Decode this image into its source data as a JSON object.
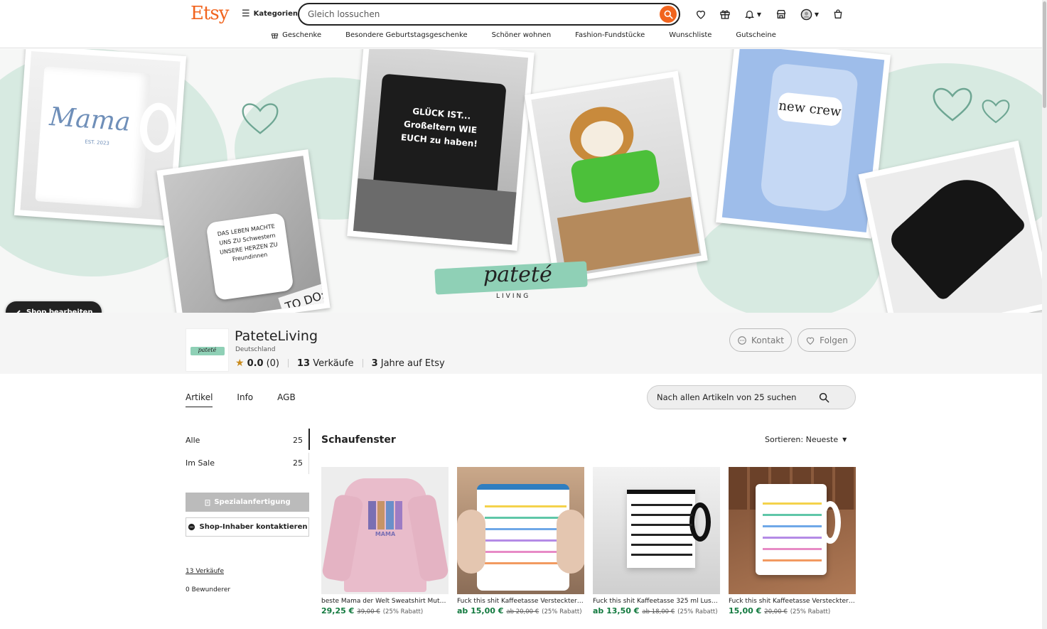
{
  "header": {
    "logo": "Etsy",
    "categories_label": "Kategorien",
    "search_placeholder": "Gleich lossuchen",
    "subnav": [
      "Geschenke",
      "Besondere Geburtstagsgeschenke",
      "Schöner wohnen",
      "Fashion-Fundstücke",
      "Wunschliste",
      "Gutscheine"
    ]
  },
  "banner": {
    "edit_label": "Shop bearbeiten",
    "brand_script": "pateté",
    "brand_sub": "LIVING",
    "mug_text": "Mama",
    "mug_sub": "EST. 2023",
    "pillow_text": "GLÜCK IST... Großeltern WIE EUCH zu haben!",
    "onesie_text": "new crew",
    "coaster_text": "DAS LEBEN MACHTE UNS ZU Schwestern UNSERE HERZEN ZU Freundinnen",
    "todo_text": "TO DO:"
  },
  "shop": {
    "name": "PateteLiving",
    "country": "Deutschland",
    "rating": "0.0",
    "rating_count": "(0)",
    "sales_num": "13",
    "sales_label": "Verkäufe",
    "years_num": "3",
    "years_label": "Jahre auf Etsy",
    "contact_label": "Kontakt",
    "follow_label": "Folgen",
    "avatar_text": "pateté"
  },
  "tabs": [
    "Artikel",
    "Info",
    "AGB"
  ],
  "item_search_placeholder": "Nach allen Artikeln von 25 suchen",
  "sidebar": {
    "sections": [
      {
        "label": "Alle",
        "count": "25"
      },
      {
        "label": "Im Sale",
        "count": "25"
      }
    ],
    "custom_label": "Spezialanfertigung",
    "contact_owner_label": "Shop-Inhaber kontaktieren",
    "sales_link": "13 Verkäufe",
    "admirers": "0 Bewunderer"
  },
  "listings": {
    "heading": "Schaufenster",
    "sort_label": "Sortieren: Neueste",
    "items": [
      {
        "title": "beste Mama der Welt Sweatshirt Mutte...",
        "price": "29,25 €",
        "old": "39,00 €",
        "discount": "(25% Rabatt)"
      },
      {
        "title": "Fuck this shit Kaffeetasse Versteckter ...",
        "price": "ab 15,00 €",
        "old": "ab 20,00 €",
        "discount": "(25% Rabatt)"
      },
      {
        "title": "Fuck this shit Kaffeetasse 325 ml Lusti...",
        "price": "ab 13,50 €",
        "old": "ab 18,00 €",
        "discount": "(25% Rabatt)"
      },
      {
        "title": "Fuck this shit Kaffeetasse Versteckter ...",
        "price": "15,00 €",
        "old": "20,00 €",
        "discount": "(25% Rabatt)"
      }
    ],
    "sweatshirt_text": "MAMA"
  },
  "colors": {
    "brand": "#f1641e",
    "price_green": "#137a3f",
    "mint": "#cfe6dc"
  }
}
